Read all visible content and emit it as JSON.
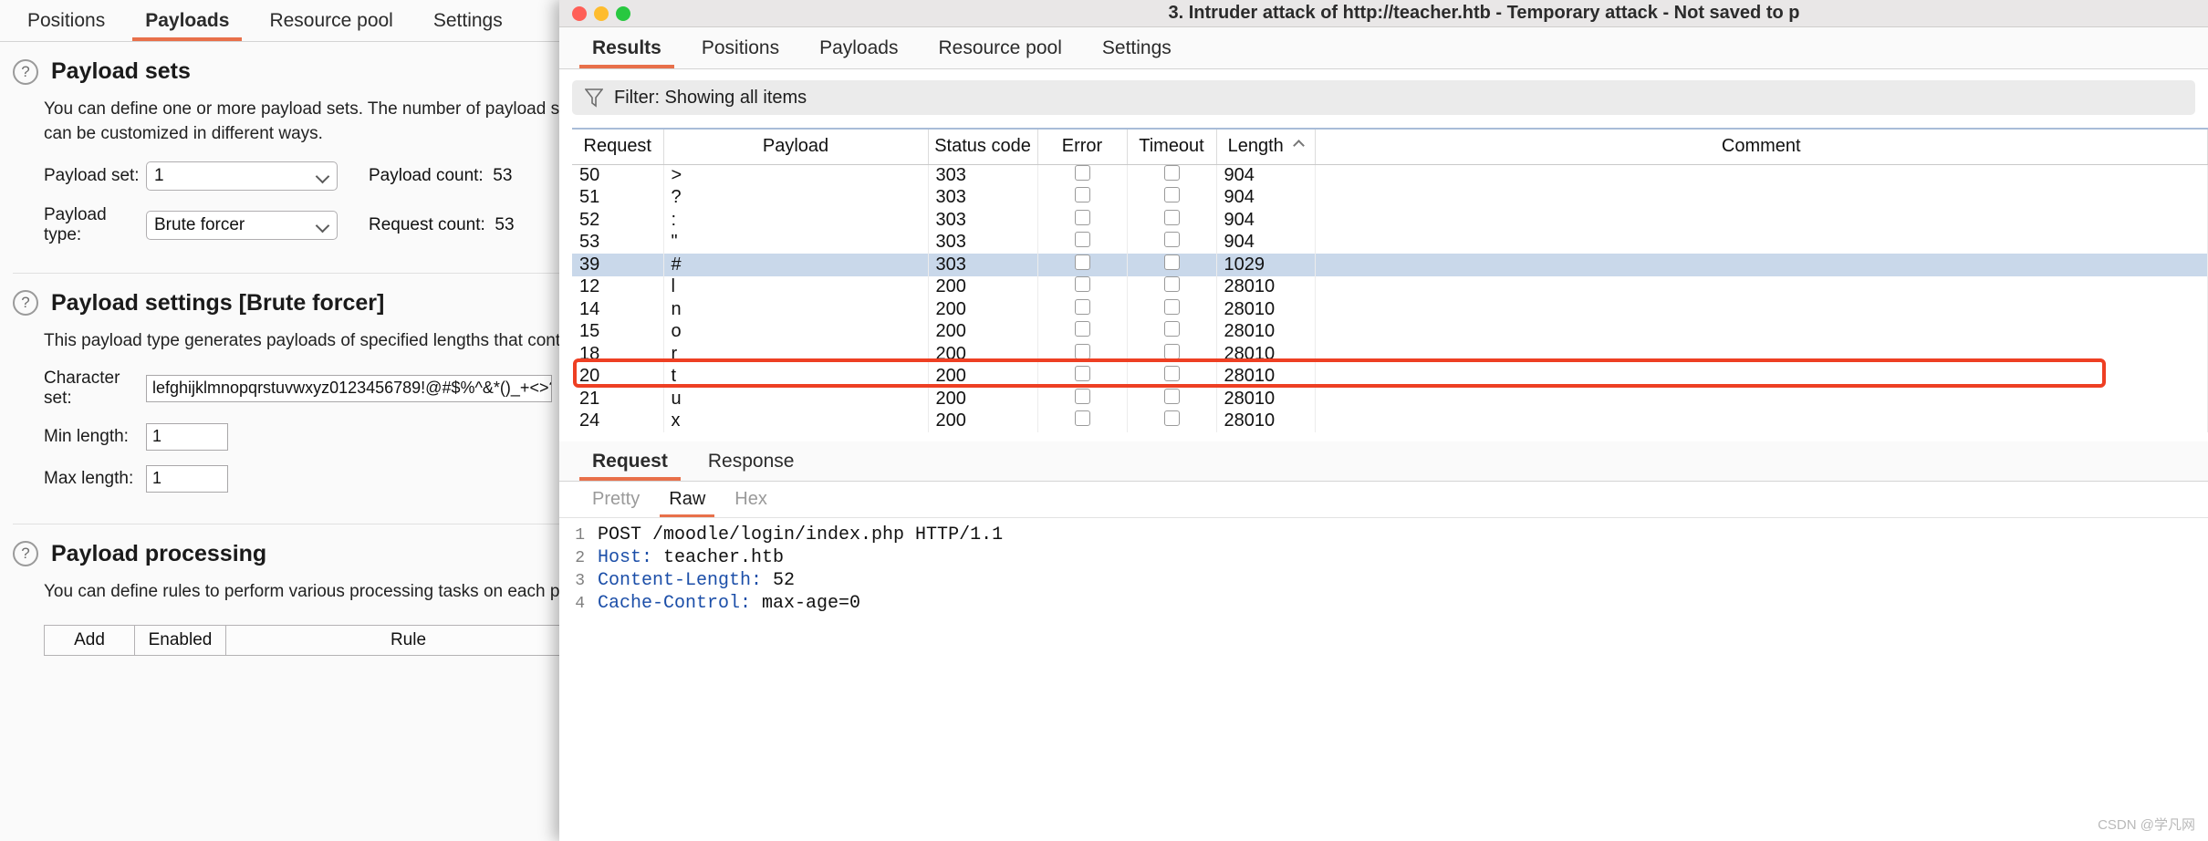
{
  "back_window": {
    "tabs": [
      {
        "label": "Positions",
        "active": false
      },
      {
        "label": "Payloads",
        "active": true
      },
      {
        "label": "Resource pool",
        "active": false
      },
      {
        "label": "Settings",
        "active": false
      }
    ],
    "payload_sets": {
      "title": "Payload sets",
      "description": "You can define one or more payload sets. The number of payload sets dep",
      "description_line2": "can be customized in different ways.",
      "payload_set_label": "Payload set:",
      "payload_set_value": "1",
      "payload_type_label": "Payload type:",
      "payload_type_value": "Brute forcer",
      "payload_count_label": "Payload count:",
      "payload_count_value": "53",
      "request_count_label": "Request count:",
      "request_count_value": "53"
    },
    "payload_settings": {
      "title": "Payload settings [Brute forcer]",
      "description": "This payload type generates payloads of specified lengths that contain all",
      "charset_label": "Character set:",
      "charset_value": "lefghijklmnopqrstuvwxyz0123456789!@#$%^&*()_+<>?:\"",
      "min_label": "Min length:",
      "min_value": "1",
      "max_label": "Max length:",
      "max_value": "1"
    },
    "payload_processing": {
      "title": "Payload processing",
      "description": "You can define rules to perform various processing tasks on each payload",
      "btn_add": "Add",
      "btn_enabled": "Enabled",
      "btn_rule": "Rule"
    }
  },
  "front_window": {
    "title": "3. Intruder attack of http://teacher.htb - Temporary attack - Not saved to p",
    "tabs": [
      {
        "label": "Results",
        "active": true
      },
      {
        "label": "Positions",
        "active": false
      },
      {
        "label": "Payloads",
        "active": false
      },
      {
        "label": "Resource pool",
        "active": false
      },
      {
        "label": "Settings",
        "active": false
      }
    ],
    "filter": {
      "icon": "funnel-icon",
      "text": "Filter: Showing all items"
    },
    "table": {
      "columns": [
        "Request",
        "Payload",
        "Status code",
        "Error",
        "Timeout",
        "Length",
        "Comment"
      ],
      "sorted_column": "Length",
      "sort_direction": "asc",
      "rows": [
        {
          "request": "50",
          "payload": ">",
          "status": "303",
          "error": false,
          "timeout": false,
          "length": "904",
          "comment": "",
          "selected": false
        },
        {
          "request": "51",
          "payload": "?",
          "status": "303",
          "error": false,
          "timeout": false,
          "length": "904",
          "comment": "",
          "selected": false
        },
        {
          "request": "52",
          "payload": ":",
          "status": "303",
          "error": false,
          "timeout": false,
          "length": "904",
          "comment": "",
          "selected": false
        },
        {
          "request": "53",
          "payload": "\"",
          "status": "303",
          "error": false,
          "timeout": false,
          "length": "904",
          "comment": "",
          "selected": false
        },
        {
          "request": "39",
          "payload": "#",
          "status": "303",
          "error": false,
          "timeout": false,
          "length": "1029",
          "comment": "",
          "selected": true
        },
        {
          "request": "12",
          "payload": "l",
          "status": "200",
          "error": false,
          "timeout": false,
          "length": "28010",
          "comment": "",
          "selected": false
        },
        {
          "request": "14",
          "payload": "n",
          "status": "200",
          "error": false,
          "timeout": false,
          "length": "28010",
          "comment": "",
          "selected": false
        },
        {
          "request": "15",
          "payload": "o",
          "status": "200",
          "error": false,
          "timeout": false,
          "length": "28010",
          "comment": "",
          "selected": false
        },
        {
          "request": "18",
          "payload": "r",
          "status": "200",
          "error": false,
          "timeout": false,
          "length": "28010",
          "comment": "",
          "selected": false
        },
        {
          "request": "20",
          "payload": "t",
          "status": "200",
          "error": false,
          "timeout": false,
          "length": "28010",
          "comment": "",
          "selected": false
        },
        {
          "request": "21",
          "payload": "u",
          "status": "200",
          "error": false,
          "timeout": false,
          "length": "28010",
          "comment": "",
          "selected": false
        },
        {
          "request": "24",
          "payload": "x",
          "status": "200",
          "error": false,
          "timeout": false,
          "length": "28010",
          "comment": "",
          "selected": false
        }
      ]
    },
    "message_tabs": [
      {
        "label": "Request",
        "active": true
      },
      {
        "label": "Response",
        "active": false
      }
    ],
    "view_tabs": [
      {
        "label": "Pretty",
        "active": false
      },
      {
        "label": "Raw",
        "active": true
      },
      {
        "label": "Hex",
        "active": false
      }
    ],
    "request_lines": [
      {
        "num": "1",
        "key": "",
        "value": "POST /moodle/login/index.php HTTP/1.1"
      },
      {
        "num": "2",
        "key": "Host:",
        "value": " teacher.htb"
      },
      {
        "num": "3",
        "key": "Content-Length:",
        "value": " 52"
      },
      {
        "num": "4",
        "key": "Cache-Control:",
        "value": " max-age=0"
      }
    ]
  },
  "watermark": "CSDN @学凡网",
  "colors": {
    "accent": "#e8704a",
    "highlight": "#ee3f23",
    "selection": "#c9d8ea",
    "header_border": "#a9bcd8"
  }
}
